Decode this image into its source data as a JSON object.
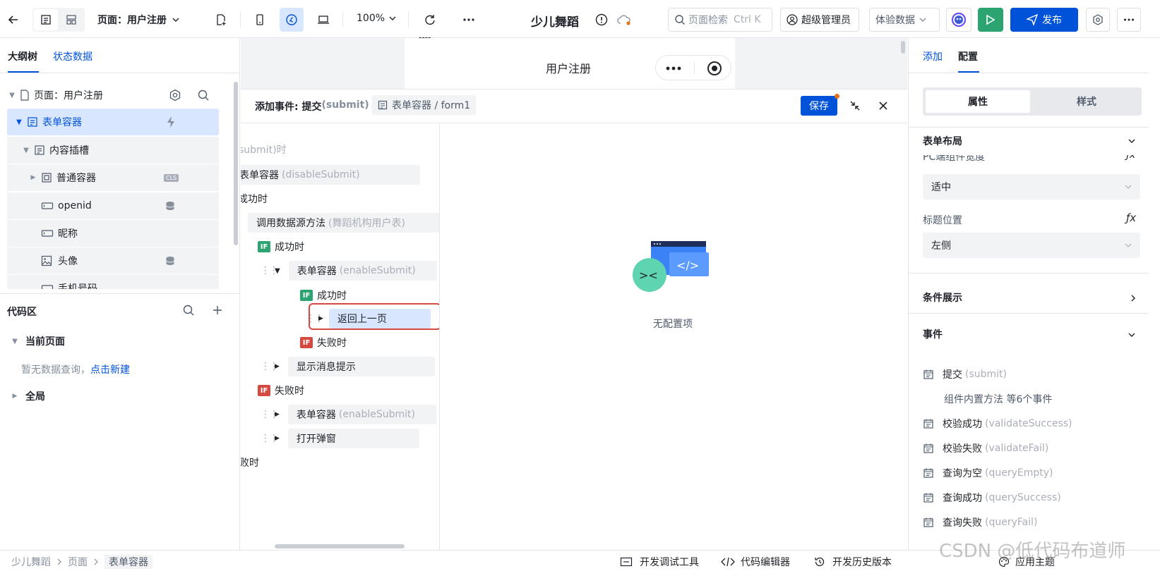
{
  "topbar": {
    "page_label": "页面：用户注册",
    "zoom": "100%",
    "app_title": "少儿舞蹈",
    "search_placeholder": "页面检索",
    "search_shortcut": "Ctrl K",
    "admin_label": "超级管理员",
    "data_mode": "体验数据",
    "publish_label": "发布"
  },
  "left": {
    "tabs": [
      "大纲树",
      "状态数据"
    ],
    "tree": [
      {
        "label": "页面：用户注册"
      },
      {
        "label": "表单容器"
      },
      {
        "label": "内容插槽"
      },
      {
        "label": "普通容器",
        "badge": "CLS"
      },
      {
        "label": "openid"
      },
      {
        "label": "昵称"
      },
      {
        "label": "头像"
      },
      {
        "label": "手机号码"
      }
    ],
    "code_title": "代码区",
    "current_page": "当前页面",
    "empty_text": "暂无数据查询，",
    "create_link": "点击新建",
    "global": "全局"
  },
  "canvas": {
    "title": "用户注册",
    "marker": "----"
  },
  "event_panel": {
    "title": "添加事件: 提交",
    "title_code": "(submit)",
    "target": "表单容器 / form1",
    "save": "保存",
    "rows": [
      {
        "text": "submit)时"
      },
      {
        "text": "表单容器",
        "code": "(disableSubmit)"
      },
      {
        "text": "成功时"
      },
      {
        "text": "调用数据源方法",
        "code": "(舞蹈机构用户表)"
      },
      {
        "badge": "IF",
        "text": "成功时"
      },
      {
        "text": "表单容器",
        "code": "(enableSubmit)"
      },
      {
        "badge": "IF",
        "text": "成功时"
      },
      {
        "text": "返回上一页"
      },
      {
        "badge": "IF",
        "text": "失败时"
      },
      {
        "text": "显示消息提示"
      },
      {
        "badge": "IF",
        "text": "失败时"
      },
      {
        "text": "表单容器",
        "code": "(enableSubmit)"
      },
      {
        "text": "打开弹窗"
      },
      {
        "text": "败时"
      }
    ],
    "empty_label": "无配置项"
  },
  "right": {
    "tabs": [
      "添加",
      "配置"
    ],
    "seg": [
      "属性",
      "样式"
    ],
    "form_layout": "表单布局",
    "pc_width_label": "PC端组件宽度",
    "pc_width_value": "适中",
    "title_pos_label": "标题位置",
    "title_pos_value": "左侧",
    "cond_display": "条件展示",
    "events_title": "事件",
    "events": [
      {
        "name": "提交",
        "code": "(submit)"
      },
      {
        "name": "组件内置方法 等6个事件",
        "code": ""
      },
      {
        "name": "校验成功",
        "code": "(validateSuccess)"
      },
      {
        "name": "校验失败",
        "code": "(validateFail)"
      },
      {
        "name": "查询为空",
        "code": "(queryEmpty)"
      },
      {
        "name": "查询成功",
        "code": "(querySuccess)"
      },
      {
        "name": "查询失败",
        "code": "(queryFail)"
      }
    ]
  },
  "statusbar": {
    "breadcrumb": [
      "少儿舞蹈",
      "页面",
      "表单容器"
    ],
    "devtools": "开发调试工具",
    "code_editor": "代码编辑器",
    "history": "开发历史版本",
    "theme": "应用主题",
    "watermark": "CSDN @低代码布道师"
  },
  "colors": {
    "primary": "#0052d9",
    "success": "#2ba471",
    "danger": "#d54941"
  }
}
